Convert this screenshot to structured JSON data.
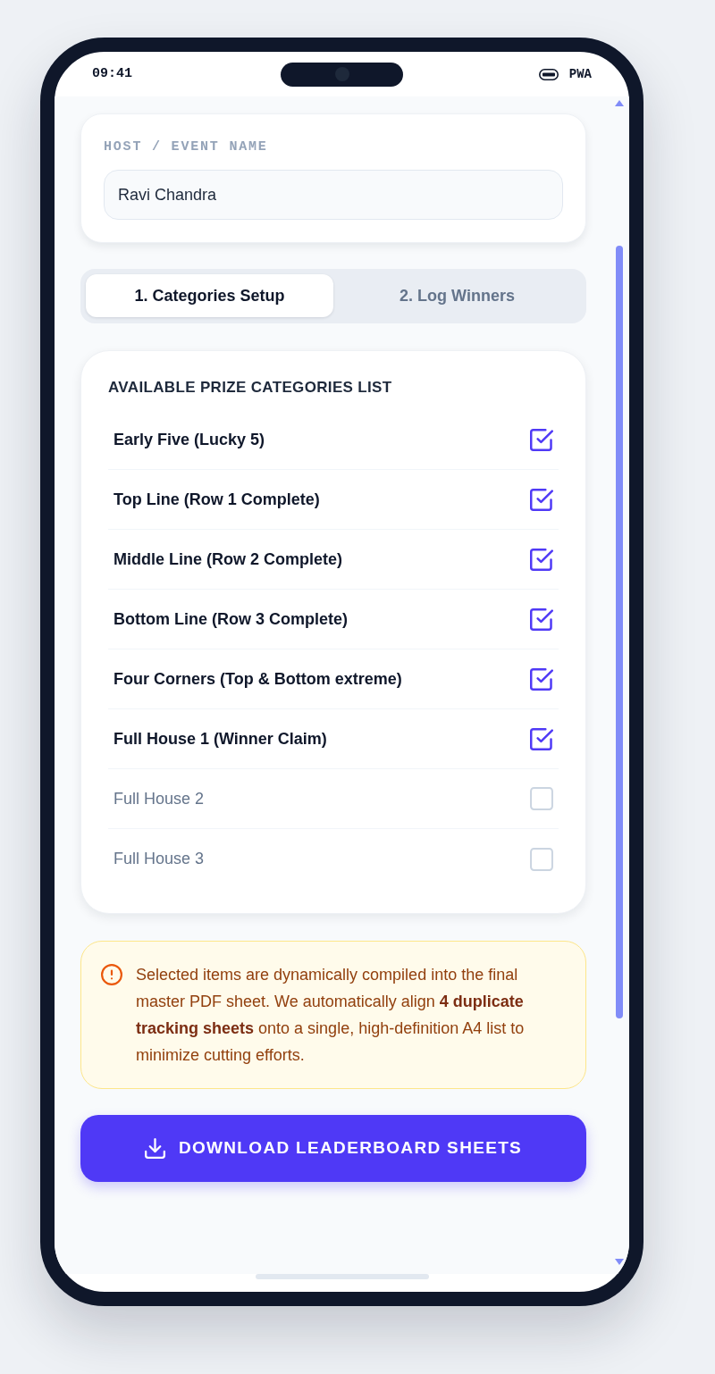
{
  "status_bar": {
    "time": "09:41",
    "label": "PWA"
  },
  "host": {
    "label": "HOST / EVENT NAME",
    "value": "Ravi Chandra"
  },
  "tabs": [
    {
      "label": "1. Categories Setup",
      "selected": true
    },
    {
      "label": "2. Log Winners",
      "selected": false
    }
  ],
  "categories_card": {
    "title": "AVAILABLE PRIZE CATEGORIES LIST",
    "items": [
      {
        "label": "Early Five (Lucky 5)",
        "checked": true
      },
      {
        "label": "Top Line (Row 1 Complete)",
        "checked": true
      },
      {
        "label": "Middle Line (Row 2 Complete)",
        "checked": true
      },
      {
        "label": "Bottom Line (Row 3 Complete)",
        "checked": true
      },
      {
        "label": "Four Corners (Top & Bottom extreme)",
        "checked": true
      },
      {
        "label": "Full House 1 (Winner Claim)",
        "checked": true
      },
      {
        "label": "Full House 2",
        "checked": false
      },
      {
        "label": "Full House 3",
        "checked": false
      }
    ]
  },
  "notice": {
    "text": "Selected items are dynamically compiled into the final master PDF sheet. We automatically align **4 duplicate tracking sheets** onto a single, high-definition A4 list to minimize cutting efforts."
  },
  "download_button": {
    "label": "DOWNLOAD LEADERBOARD SHEETS"
  }
}
